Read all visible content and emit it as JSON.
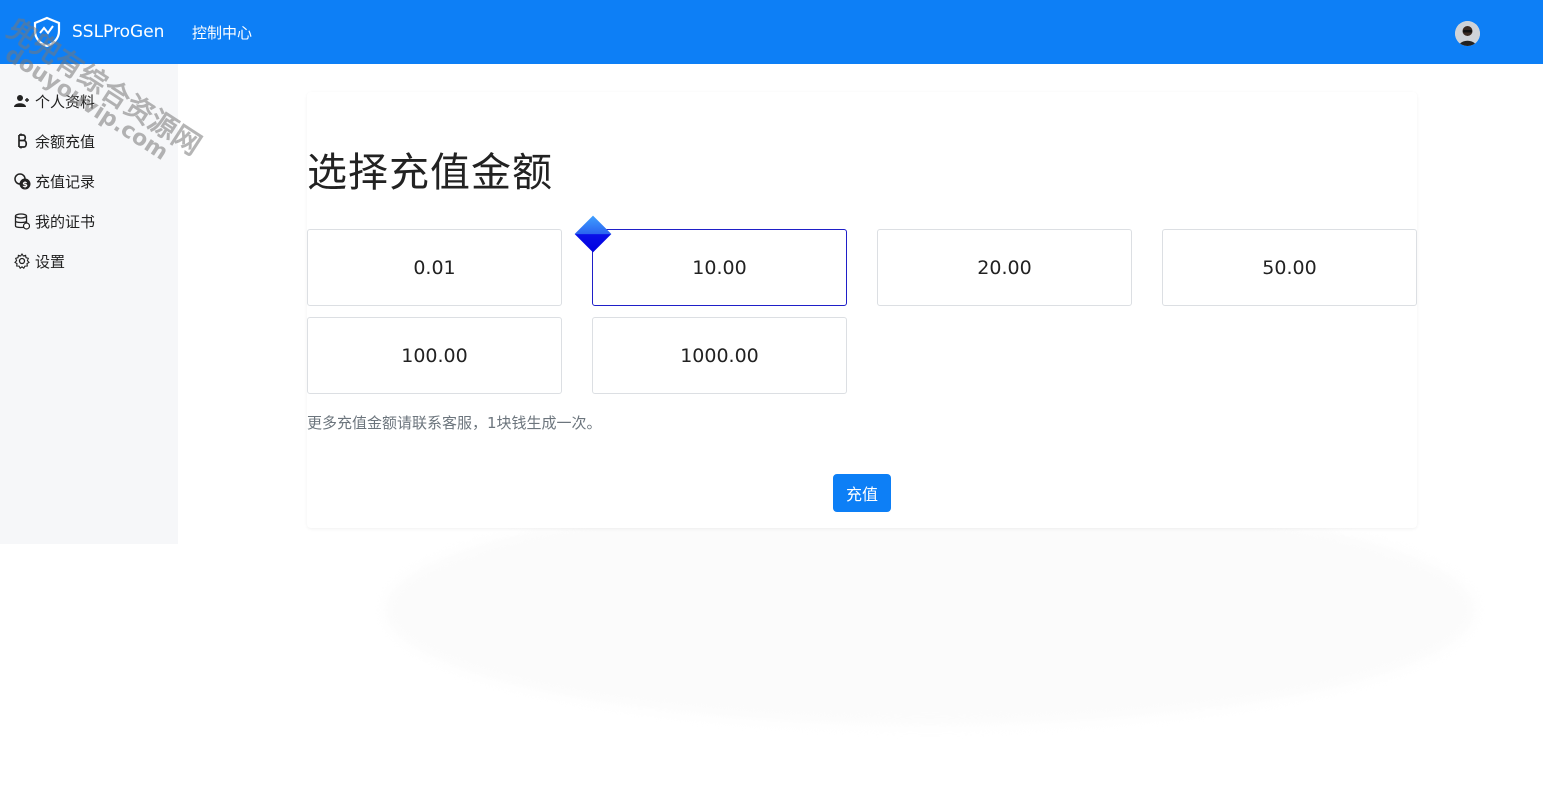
{
  "navbar": {
    "brand": "SSLProGen",
    "nav_link": "控制中心",
    "colors": {
      "background": "#0d7ff6",
      "text": "#ffffff"
    },
    "avatar_icon": "user-avatar-icon"
  },
  "sidebar": {
    "items": [
      {
        "label": "个人资料",
        "icon": "user-plus-icon"
      },
      {
        "label": "余额充值",
        "icon": "bitcoin-icon"
      },
      {
        "label": "充值记录",
        "icon": "coins-icon"
      },
      {
        "label": "我的证书",
        "icon": "database-icon"
      },
      {
        "label": "设置",
        "icon": "gear-icon"
      }
    ]
  },
  "main": {
    "title": "选择充值金额",
    "amounts": [
      "0.01",
      "10.00",
      "20.00",
      "50.00",
      "100.00",
      "1000.00"
    ],
    "selected_amount": "10.00",
    "hint": "更多充值金额请联系客服，1块钱生成一次。",
    "recharge_button": "充值"
  },
  "watermark": {
    "line1": "兜兜有综合资源网",
    "line2": "douyouvip.com"
  }
}
